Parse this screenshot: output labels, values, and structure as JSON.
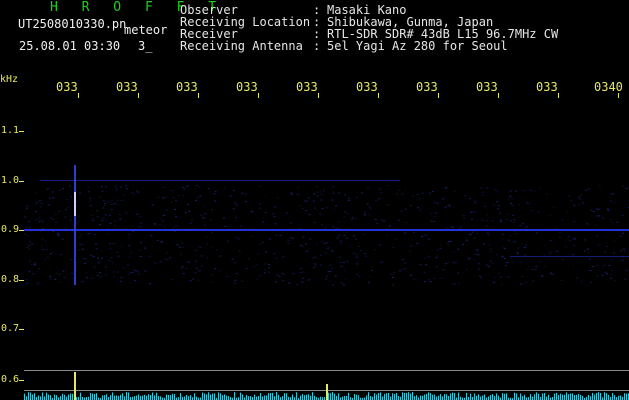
{
  "header": {
    "app_title": "H R O F F T",
    "filename": "UT2508010330.pn",
    "filename_suffix": "meteor",
    "datetime": "25.08.01 03:30",
    "count": "3_"
  },
  "info": {
    "rows": [
      {
        "key": "Observer",
        "value": "Masaki Kano"
      },
      {
        "key": "Receiving Location",
        "value": "Shibukawa, Gunma, Japan"
      },
      {
        "key": "Receiver",
        "value": "RTL-SDR SDR# 43dB L15 96.7MHz CW"
      },
      {
        "key": "Receiving Antenna",
        "value": "5el Yagi Az 280 for Seoul"
      }
    ]
  },
  "axis": {
    "unit": "kHz",
    "time_labels": [
      "033",
      "033",
      "033",
      "033",
      "033",
      "033",
      "033",
      "033",
      "033",
      "0340"
    ],
    "freq_labels": [
      "1.1",
      "1.0",
      "0.9",
      "0.8",
      "0.7",
      "0.6"
    ]
  },
  "colors": {
    "background": "#000000",
    "axis": "#e8e860",
    "title": "#19d219",
    "signal": "#2a3cff",
    "meteor_head": "#d0d0ff",
    "spectrum": "#20d0e0"
  }
}
